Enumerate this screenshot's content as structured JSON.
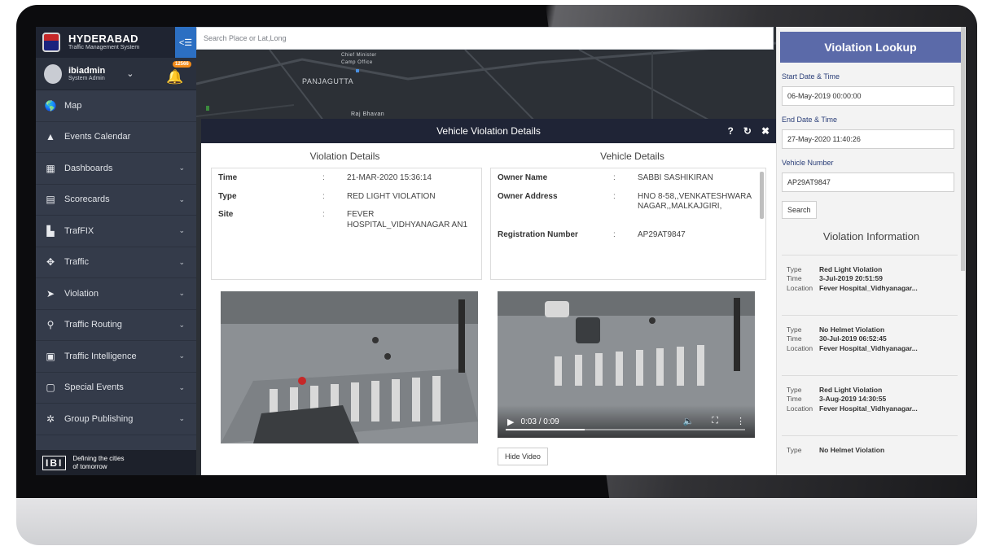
{
  "sidebar": {
    "brand_title": "HYDERABAD",
    "brand_subtitle": "Traffic Management System",
    "collapse_icon": "menu-collapse-icon",
    "user_name": "ibiadmin",
    "user_role": "System Admin",
    "notification_count": "12566",
    "items": [
      {
        "label": "Map",
        "icon": "globe-icon",
        "has_chevron": false
      },
      {
        "label": "Events Calendar",
        "icon": "warning-icon",
        "has_chevron": false
      },
      {
        "label": "Dashboards",
        "icon": "dashboard-icon",
        "has_chevron": true
      },
      {
        "label": "Scorecards",
        "icon": "scorecard-icon",
        "has_chevron": true
      },
      {
        "label": "TrafFIX",
        "icon": "document-icon",
        "has_chevron": true
      },
      {
        "label": "Traffic",
        "icon": "traffic-light-icon",
        "has_chevron": true
      },
      {
        "label": "Violation",
        "icon": "runner-icon",
        "has_chevron": true
      },
      {
        "label": "Traffic Routing",
        "icon": "route-icon",
        "has_chevron": true
      },
      {
        "label": "Traffic Intelligence",
        "icon": "intelligence-icon",
        "has_chevron": true
      },
      {
        "label": "Special Events",
        "icon": "calendar-icon",
        "has_chevron": true
      },
      {
        "label": "Group Publishing",
        "icon": "group-icon",
        "has_chevron": true
      }
    ],
    "footer_logo": "IBI",
    "footer_line1": "Defining the cities",
    "footer_line2": "of tomorrow"
  },
  "map": {
    "search_placeholder": "Search Place or Lat,Long",
    "labels": {
      "panjagutta": "PANJAGUTTA",
      "camp": "Camp Office",
      "minar": "Chief Minister",
      "raj": "Raj Bhavan"
    }
  },
  "modal": {
    "title": "Vehicle Violation Details",
    "tools": [
      "?",
      "↻",
      "✖"
    ],
    "violation_title": "Violation Details",
    "vehicle_title": "Vehicle Details",
    "violation_rows": [
      {
        "key": "Time",
        "value": "21-MAR-2020 15:36:14"
      },
      {
        "key": "Type",
        "value": "RED LIGHT VIOLATION"
      },
      {
        "key": "Site",
        "value": "FEVER HOSPITAL_VIDHYANAGAR AN1"
      }
    ],
    "vehicle_rows": [
      {
        "key": "Owner Name",
        "value": "SABBI SASHIKIRAN"
      },
      {
        "key": "Owner Address",
        "value": "HNO 8-58,,VENKATESHWARA NAGAR,,MALKAJGIRI,"
      },
      {
        "key": "Registration Number",
        "value": "AP29AT9847"
      }
    ],
    "separator": ":",
    "video": {
      "time": "0:03 / 0:09",
      "progress": 0.33
    },
    "hide_video_label": "Hide Video"
  },
  "panel": {
    "title": "Violation Lookup",
    "start_label": "Start Date & Time",
    "start_value": "06-May-2019 00:00:00",
    "end_label": "End Date & Time",
    "end_value": "27-May-2020 11:40:26",
    "vehicle_label": "Vehicle Number",
    "vehicle_value": "AP29AT9847",
    "search_label": "Search",
    "info_title": "Violation Information",
    "field_labels": {
      "type": "Type",
      "time": "Time",
      "location": "Location"
    },
    "records": [
      {
        "type": "Red Light Violation",
        "time": "3-Jul-2019 20:51:59",
        "location": "Fever Hospital_Vidhyanagar..."
      },
      {
        "type": "No Helmet Violation",
        "time": "30-Jul-2019 06:52:45",
        "location": "Fever Hospital_Vidhyanagar..."
      },
      {
        "type": "Red Light Violation",
        "time": "3-Aug-2019 14:30:55",
        "location": "Fever Hospital_Vidhyanagar..."
      },
      {
        "type": "No Helmet Violation",
        "time": "",
        "location": ""
      }
    ]
  }
}
